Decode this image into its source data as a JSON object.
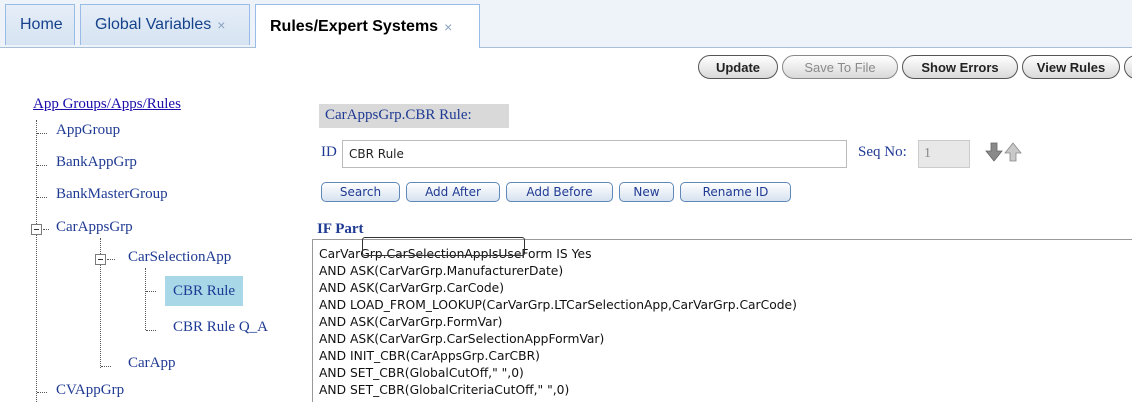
{
  "tabs": [
    {
      "label": "Home",
      "closable": false,
      "active": false
    },
    {
      "label": "Global Variables",
      "closable": true,
      "active": false
    },
    {
      "label": "Rules/Expert Systems",
      "closable": true,
      "active": true
    }
  ],
  "tab_close_glyph": "×",
  "toolbar": {
    "update": "Update",
    "save_to_file": "Save To File",
    "show_errors": "Show Errors",
    "view_rules": "View Rules"
  },
  "tree": {
    "title": "App Groups/Apps/Rules",
    "nodes": {
      "app_group": "AppGroup",
      "bank_app_grp": "BankAppGrp",
      "bank_master_group": "BankMasterGroup",
      "car_apps_grp": "CarAppsGrp",
      "car_selection_app": "CarSelectionApp",
      "cbr_rule": "CBR Rule",
      "cbr_rule_qa": "CBR Rule Q_A",
      "car_app": "CarApp",
      "cv_app_grp": "CVAppGrp"
    },
    "selected": "CBR Rule"
  },
  "rule": {
    "header": "CarAppsGrp.CBR Rule:",
    "id_label": "ID",
    "id_value": "CBR Rule",
    "seq_label": "Seq No:",
    "seq_value": "1"
  },
  "actions": {
    "search": "Search",
    "add_after": "Add After",
    "add_before": "Add Before",
    "new": "New",
    "rename_id": "Rename ID"
  },
  "if_part": {
    "label": "IF Part",
    "lines": [
      "CarVarGrp.CarSelectionAppIsUseForm IS Yes",
      "AND ASK(CarVarGrp.ManufacturerDate)",
      "AND ASK(CarVarGrp.CarCode)",
      "AND LOAD_FROM_LOOKUP(CarVarGrp.LTCarSelectionApp,CarVarGrp.CarCode)",
      "AND ASK(CarVarGrp.FormVar)",
      "AND ASK(CarVarGrp.CarSelectionAppFormVar)",
      "AND INIT_CBR(CarAppsGrp.CarCBR)",
      "AND SET_CBR(GlobalCutOff,\" \",0)",
      "AND SET_CBR(GlobalCriteriaCutOff,\" \",0)"
    ]
  },
  "colors": {
    "tab_text": "#15428b",
    "link": "#1a0dab",
    "tree_text": "#1f3a93",
    "selected_bg": "#a8d8e8",
    "header_bg": "#d9d9d9"
  },
  "icons": [
    "close-icon",
    "arrow-down-icon",
    "arrow-up-icon",
    "expand-collapse-icon"
  ]
}
